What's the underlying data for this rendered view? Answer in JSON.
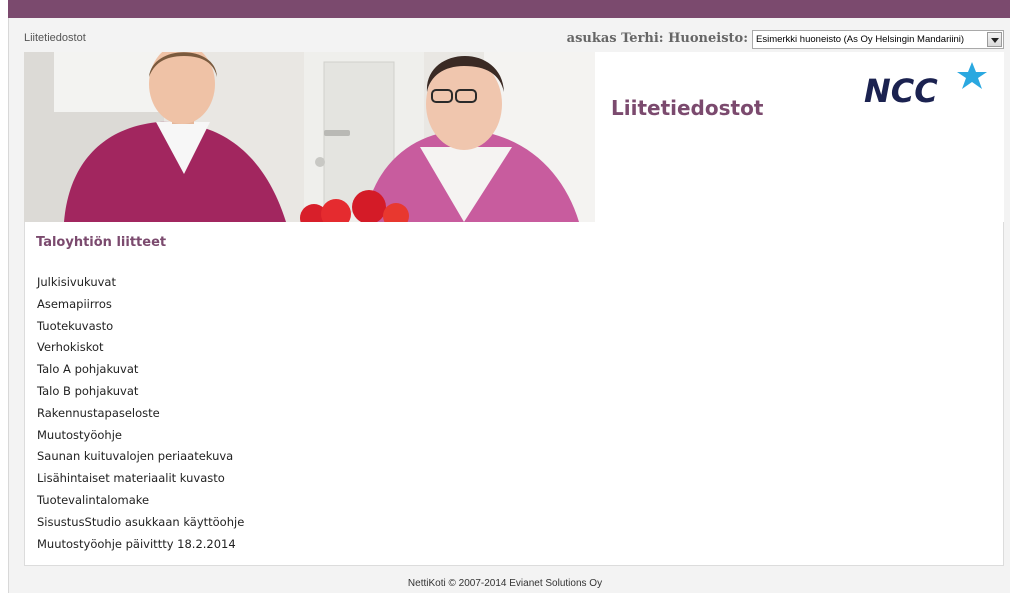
{
  "breadcrumb": "Liitetiedostot",
  "resident_label": "asukas Terhi: Huoneisto:",
  "apartment_select": {
    "selected": "Esimerkki huoneisto (As Oy Helsingin Mandariini)"
  },
  "header": {
    "title": "Liitetiedostot",
    "logo_text": "NCC"
  },
  "attachments": {
    "title": "Taloyhtiön liitteet",
    "items": [
      "Julkisivukuvat",
      "Asemapiirros",
      "Tuotekuvasto",
      "Verhokiskot",
      "Talo A pohjakuvat",
      "Talo B pohjakuvat",
      "Rakennustapaseloste",
      "Muutostyöohje",
      "Saunan kuituvalojen periaatekuva",
      "Lisähintaiset materiaalit kuvasto",
      "Tuotevalintalomake",
      "SisustusStudio asukkaan käyttöohje",
      "Muutostyöohje päivittty 18.2.2014"
    ]
  },
  "footer": "NettiKoti © 2007-2014 Evianet Solutions Oy",
  "colors": {
    "brand": "#7b4a6e",
    "logo_navy": "#1b2250",
    "logo_star": "#2aa8e0"
  }
}
